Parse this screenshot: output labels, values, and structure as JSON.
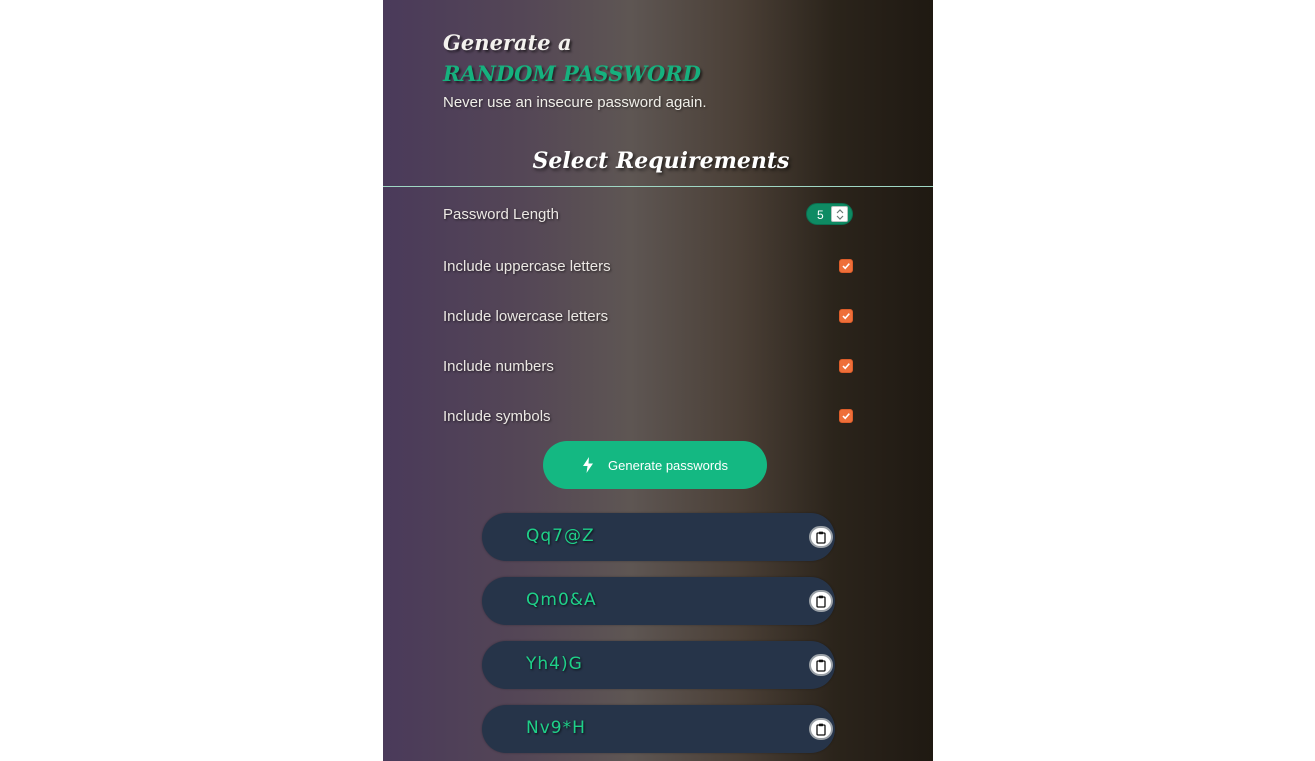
{
  "hero": {
    "line1": "Generate a",
    "line2": "RANDOM PASSWORD",
    "tagline": "Never use an insecure password again."
  },
  "requirements": {
    "title": "Select Requirements",
    "length": {
      "label": "Password Length",
      "value": "5"
    },
    "uppercase": {
      "label": "Include uppercase letters",
      "checked": true
    },
    "lowercase": {
      "label": "Include lowercase letters",
      "checked": true
    },
    "numbers": {
      "label": "Include numbers",
      "checked": true
    },
    "symbols": {
      "label": "Include symbols",
      "checked": true
    }
  },
  "generate": {
    "label": "Generate passwords",
    "icon": "lightning-bolt-icon"
  },
  "passwords": [
    {
      "value": "Qq7@Z",
      "copy_icon": "clipboard-icon"
    },
    {
      "value": "Qm0&A",
      "copy_icon": "clipboard-icon"
    },
    {
      "value": "Yh4)G",
      "copy_icon": "clipboard-icon"
    },
    {
      "value": "Nv9*H",
      "copy_icon": "clipboard-icon"
    }
  ],
  "colors": {
    "accent_green": "#14b882",
    "password_text": "#1fd089",
    "checkbox_orange": "#ee6f3a",
    "password_box": "#263449"
  }
}
